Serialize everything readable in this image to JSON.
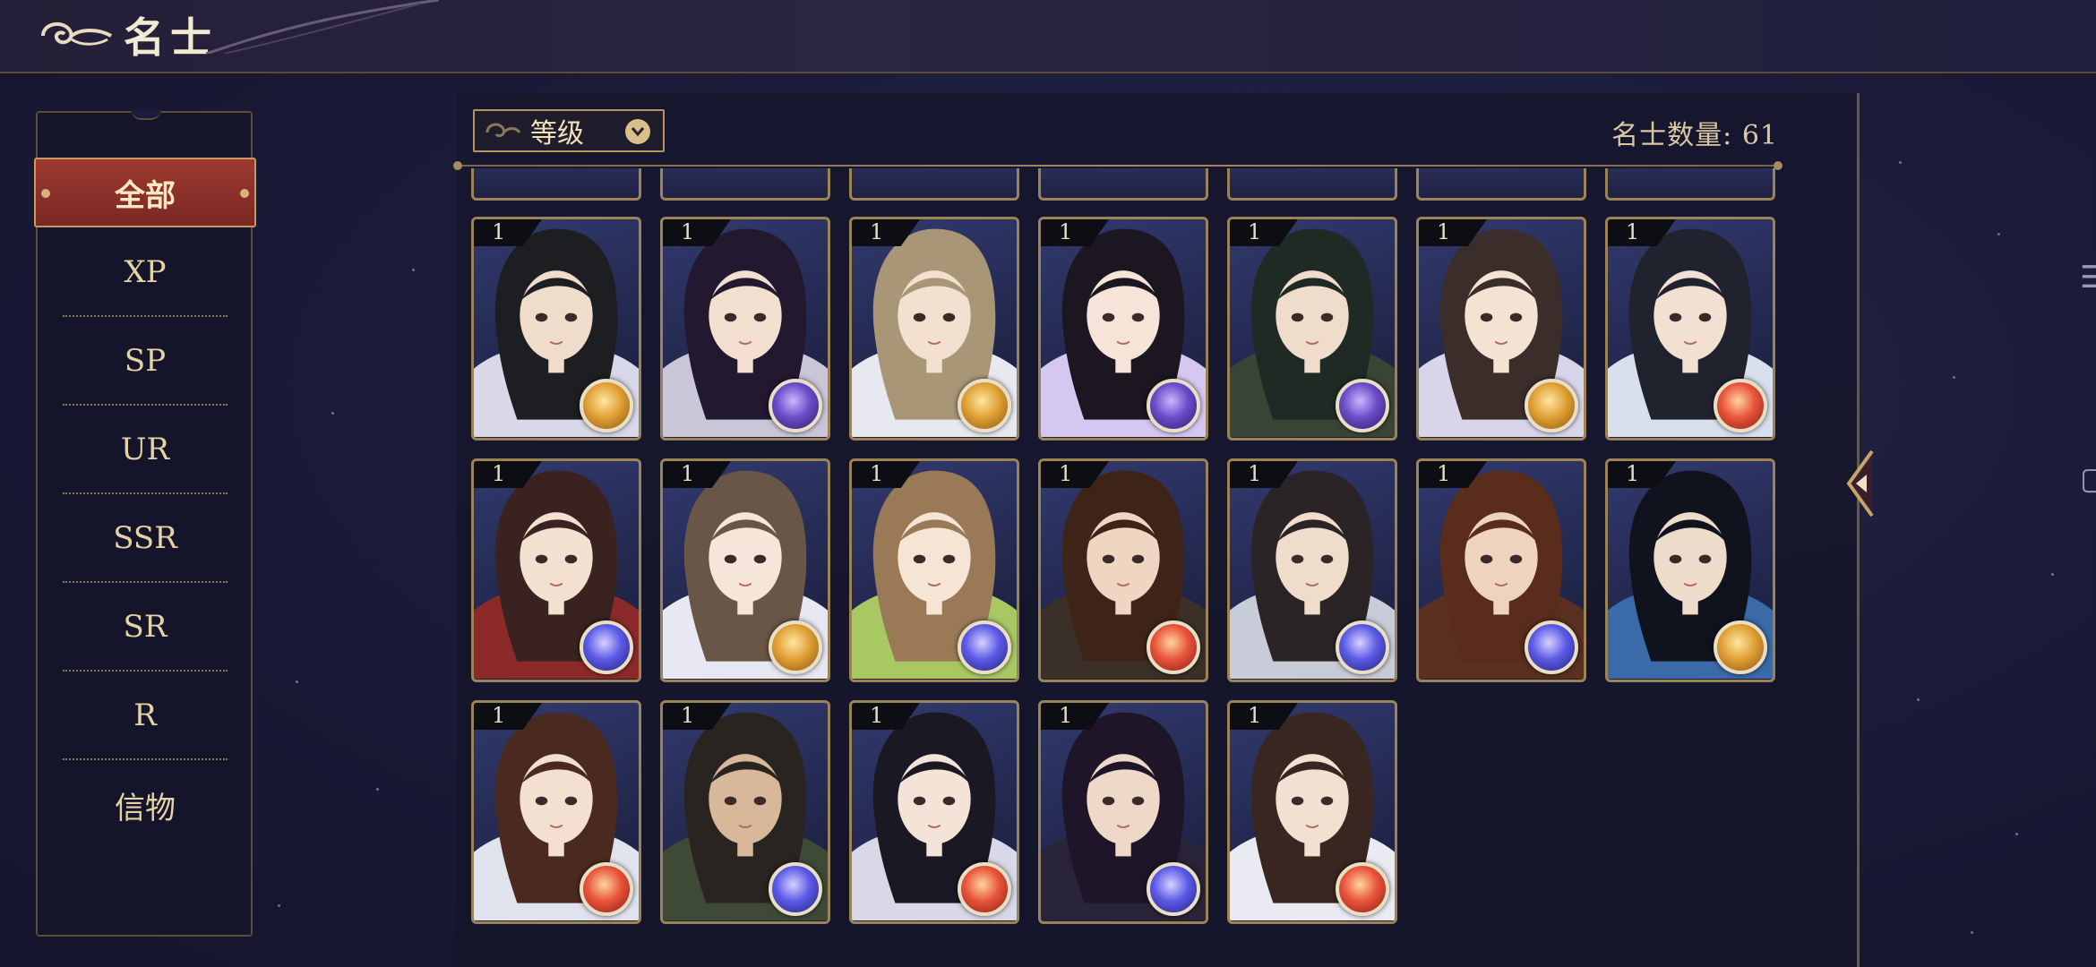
{
  "header": {
    "title": "名士"
  },
  "sidebar": {
    "categories": [
      {
        "label": "全部",
        "active": true
      },
      {
        "label": "XP"
      },
      {
        "label": "SP"
      },
      {
        "label": "UR"
      },
      {
        "label": "SSR"
      },
      {
        "label": "SR"
      },
      {
        "label": "R"
      },
      {
        "label": "信物"
      }
    ]
  },
  "toolbar": {
    "sort_label": "等级",
    "count_label": "名士数量:",
    "count_value": "61"
  },
  "cards": [
    {
      "level": "1",
      "element": "gold",
      "hair": "#1c1e22",
      "skin": "#f0dccb",
      "robe": "#d8d8e8"
    },
    {
      "level": "1",
      "element": "moon",
      "hair": "#221830",
      "skin": "#f2dfd0",
      "robe": "#c9c6d8"
    },
    {
      "level": "1",
      "element": "gold",
      "hair": "#a89676",
      "skin": "#f4e0cf",
      "robe": "#e8e8f0"
    },
    {
      "level": "1",
      "element": "moon",
      "hair": "#1b1620",
      "skin": "#f6e4d8",
      "robe": "#d4c8f0"
    },
    {
      "level": "1",
      "element": "moon",
      "hair": "#1f2a24",
      "skin": "#f0dccb",
      "robe": "#3a4436"
    },
    {
      "level": "1",
      "element": "gold",
      "hair": "#3a2d2a",
      "skin": "#f4e2d2",
      "robe": "#d8d4ea"
    },
    {
      "level": "1",
      "element": "sun",
      "hair": "#20222e",
      "skin": "#f2e0d2",
      "robe": "#d8e0ee"
    },
    {
      "level": "1",
      "element": "blue",
      "hair": "#3a2220",
      "skin": "#f4e0d0",
      "robe": "#8c2a2a"
    },
    {
      "level": "1",
      "element": "gold",
      "hair": "#6a5646",
      "skin": "#f6e6da",
      "robe": "#e8e8f4"
    },
    {
      "level": "1",
      "element": "blue",
      "hair": "#9a7a56",
      "skin": "#f6e4d4",
      "robe": "#a8c864"
    },
    {
      "level": "1",
      "element": "sun",
      "hair": "#3e2418",
      "skin": "#eed6c2",
      "robe": "#3a3028"
    },
    {
      "level": "1",
      "element": "blue",
      "hair": "#2a2426",
      "skin": "#f0dccb",
      "robe": "#c8ccd8"
    },
    {
      "level": "1",
      "element": "blue",
      "hair": "#5a2c1c",
      "skin": "#eed4be",
      "robe": "#5a3020"
    },
    {
      "level": "1",
      "element": "gold",
      "hair": "#10131e",
      "skin": "#eedcca",
      "robe": "#3a6aa8"
    },
    {
      "level": "1",
      "element": "sun",
      "hair": "#4a2a1e",
      "skin": "#f4e0d0",
      "robe": "#e0e2ee"
    },
    {
      "level": "1",
      "element": "blue",
      "hair": "#2a2420",
      "skin": "#d8b89a",
      "robe": "#3e4a36"
    },
    {
      "level": "1",
      "element": "sun",
      "hair": "#1a1822",
      "skin": "#f4e4d8",
      "robe": "#d8d8e8"
    },
    {
      "level": "1",
      "element": "blue",
      "hair": "#1e1628",
      "skin": "#eed8c8",
      "robe": "#2a2438"
    },
    {
      "level": "1",
      "element": "sun",
      "hair": "#3a2620",
      "skin": "#f2e0d0",
      "robe": "#eaeaf2"
    }
  ]
}
